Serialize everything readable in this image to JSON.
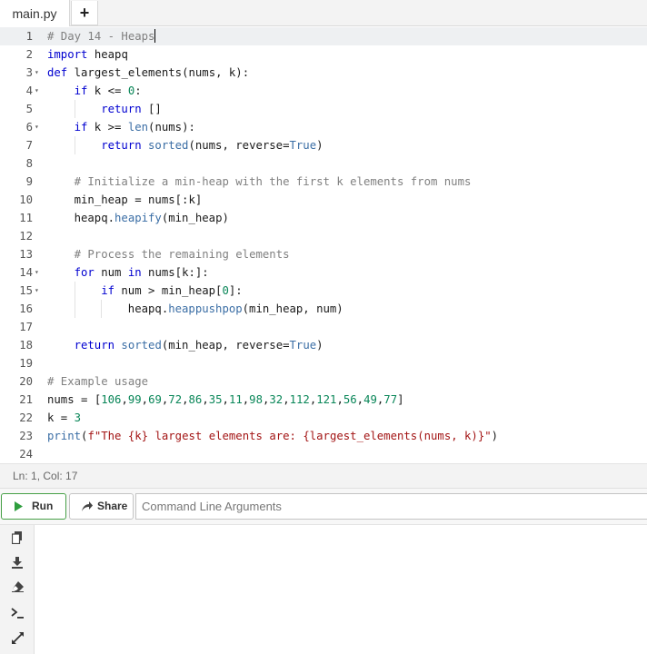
{
  "tabs": [
    {
      "label": "main.py"
    }
  ],
  "tab_add_label": "+",
  "editor": {
    "lines": [
      {
        "n": "1",
        "fold": false,
        "indent": 0
      },
      {
        "n": "2",
        "fold": false,
        "indent": 0
      },
      {
        "n": "3",
        "fold": true,
        "indent": 0
      },
      {
        "n": "4",
        "fold": true,
        "indent": 1
      },
      {
        "n": "5",
        "fold": false,
        "indent": 2
      },
      {
        "n": "6",
        "fold": true,
        "indent": 1
      },
      {
        "n": "7",
        "fold": false,
        "indent": 2
      },
      {
        "n": "8",
        "fold": false,
        "indent": 0
      },
      {
        "n": "9",
        "fold": false,
        "indent": 1
      },
      {
        "n": "10",
        "fold": false,
        "indent": 1
      },
      {
        "n": "11",
        "fold": false,
        "indent": 1
      },
      {
        "n": "12",
        "fold": false,
        "indent": 0
      },
      {
        "n": "13",
        "fold": false,
        "indent": 1
      },
      {
        "n": "14",
        "fold": true,
        "indent": 1
      },
      {
        "n": "15",
        "fold": true,
        "indent": 2
      },
      {
        "n": "16",
        "fold": false,
        "indent": 3
      },
      {
        "n": "17",
        "fold": false,
        "indent": 0
      },
      {
        "n": "18",
        "fold": false,
        "indent": 1
      },
      {
        "n": "19",
        "fold": false,
        "indent": 0
      },
      {
        "n": "20",
        "fold": false,
        "indent": 0
      },
      {
        "n": "21",
        "fold": false,
        "indent": 0
      },
      {
        "n": "22",
        "fold": false,
        "indent": 0
      },
      {
        "n": "23",
        "fold": false,
        "indent": 0
      },
      {
        "n": "24",
        "fold": false,
        "indent": 0
      }
    ],
    "code": [
      [
        {
          "t": "# Day 14 - Heaps",
          "c": "c"
        }
      ],
      [
        {
          "t": "import",
          "c": "k"
        },
        {
          "t": " heapq",
          "c": ""
        }
      ],
      [
        {
          "t": "def",
          "c": "k"
        },
        {
          "t": " largest_elements(nums, k):",
          "c": ""
        }
      ],
      [
        {
          "t": "if",
          "c": "k"
        },
        {
          "t": " k <= ",
          "c": ""
        },
        {
          "t": "0",
          "c": "n"
        },
        {
          "t": ":",
          "c": ""
        }
      ],
      [
        {
          "t": "return",
          "c": "k"
        },
        {
          "t": " []",
          "c": ""
        }
      ],
      [
        {
          "t": "if",
          "c": "k"
        },
        {
          "t": " k >= ",
          "c": ""
        },
        {
          "t": "len",
          "c": "b"
        },
        {
          "t": "(nums):",
          "c": ""
        }
      ],
      [
        {
          "t": "return",
          "c": "k"
        },
        {
          "t": " ",
          "c": ""
        },
        {
          "t": "sorted",
          "c": "b"
        },
        {
          "t": "(nums, reverse=",
          "c": ""
        },
        {
          "t": "True",
          "c": "b"
        },
        {
          "t": ")",
          "c": ""
        }
      ],
      [],
      [
        {
          "t": "# Initialize a min-heap with the first k elements from nums",
          "c": "c"
        }
      ],
      [
        {
          "t": "min_heap = nums[:k]",
          "c": ""
        }
      ],
      [
        {
          "t": "heapq.",
          "c": ""
        },
        {
          "t": "heapify",
          "c": "b"
        },
        {
          "t": "(min_heap)",
          "c": ""
        }
      ],
      [],
      [
        {
          "t": "# Process the remaining elements",
          "c": "c"
        }
      ],
      [
        {
          "t": "for",
          "c": "k"
        },
        {
          "t": " num ",
          "c": ""
        },
        {
          "t": "in",
          "c": "k"
        },
        {
          "t": " nums[k:]:",
          "c": ""
        }
      ],
      [
        {
          "t": "if",
          "c": "k"
        },
        {
          "t": " num > min_heap[",
          "c": ""
        },
        {
          "t": "0",
          "c": "n"
        },
        {
          "t": "]:",
          "c": ""
        }
      ],
      [
        {
          "t": "heapq.",
          "c": ""
        },
        {
          "t": "heappushpop",
          "c": "b"
        },
        {
          "t": "(min_heap, num)",
          "c": ""
        }
      ],
      [],
      [
        {
          "t": "return",
          "c": "k"
        },
        {
          "t": " ",
          "c": ""
        },
        {
          "t": "sorted",
          "c": "b"
        },
        {
          "t": "(min_heap, reverse=",
          "c": ""
        },
        {
          "t": "True",
          "c": "b"
        },
        {
          "t": ")",
          "c": ""
        }
      ],
      [],
      [
        {
          "t": "# Example usage",
          "c": "c"
        }
      ],
      [
        {
          "t": "nums = [",
          "c": ""
        },
        {
          "t": "106",
          "c": "n"
        },
        {
          "t": ",",
          "c": ""
        },
        {
          "t": "99",
          "c": "n"
        },
        {
          "t": ",",
          "c": ""
        },
        {
          "t": "69",
          "c": "n"
        },
        {
          "t": ",",
          "c": ""
        },
        {
          "t": "72",
          "c": "n"
        },
        {
          "t": ",",
          "c": ""
        },
        {
          "t": "86",
          "c": "n"
        },
        {
          "t": ",",
          "c": ""
        },
        {
          "t": "35",
          "c": "n"
        },
        {
          "t": ",",
          "c": ""
        },
        {
          "t": "11",
          "c": "n"
        },
        {
          "t": ",",
          "c": ""
        },
        {
          "t": "98",
          "c": "n"
        },
        {
          "t": ",",
          "c": ""
        },
        {
          "t": "32",
          "c": "n"
        },
        {
          "t": ",",
          "c": ""
        },
        {
          "t": "112",
          "c": "n"
        },
        {
          "t": ",",
          "c": ""
        },
        {
          "t": "121",
          "c": "n"
        },
        {
          "t": ",",
          "c": ""
        },
        {
          "t": "56",
          "c": "n"
        },
        {
          "t": ",",
          "c": ""
        },
        {
          "t": "49",
          "c": "n"
        },
        {
          "t": ",",
          "c": ""
        },
        {
          "t": "77",
          "c": "n"
        },
        {
          "t": "]",
          "c": ""
        }
      ],
      [
        {
          "t": "k = ",
          "c": ""
        },
        {
          "t": "3",
          "c": "n"
        }
      ],
      [
        {
          "t": "print",
          "c": "b"
        },
        {
          "t": "(",
          "c": ""
        },
        {
          "t": "f\"The {k} largest elements are: {largest_elements(nums, k)}\"",
          "c": "s"
        },
        {
          "t": ")",
          "c": ""
        }
      ],
      []
    ]
  },
  "status": {
    "text": "Ln: 1,  Col: 17"
  },
  "toolbar": {
    "run_label": "Run",
    "share_label": "Share",
    "args_placeholder": "Command Line Arguments",
    "run_color": "#2e9e3e"
  },
  "sidebar_icons": [
    "copy-icon",
    "download-icon",
    "eraser-icon",
    "terminal-icon",
    "expand-icon"
  ],
  "output": {
    "text": ""
  }
}
